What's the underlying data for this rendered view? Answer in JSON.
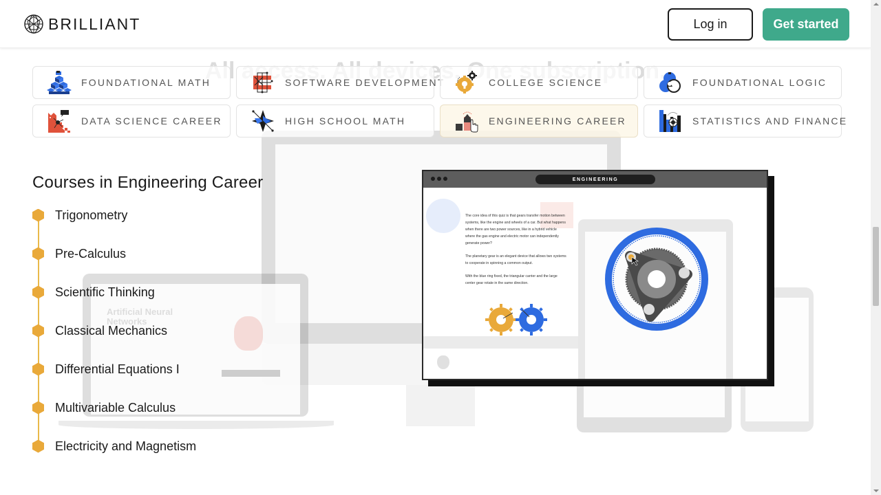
{
  "header": {
    "logo_text": "BRILLIANT",
    "login_label": "Log in",
    "get_started_label": "Get started",
    "accent_color": "#3fa98b"
  },
  "background": {
    "tagline": "All access. All devices. One subscription.",
    "laptop_caption": "Artificial Neural Networks"
  },
  "categories": [
    {
      "label": "Foundational Math",
      "icon": "foundational-math-icon",
      "active": false
    },
    {
      "label": "Software Development",
      "icon": "software-development-icon",
      "active": false
    },
    {
      "label": "College Science",
      "icon": "college-science-icon",
      "active": false
    },
    {
      "label": "Foundational Logic",
      "icon": "foundational-logic-icon",
      "active": false
    },
    {
      "label": "Data Science Career",
      "icon": "data-science-career-icon",
      "active": false
    },
    {
      "label": "High School Math",
      "icon": "high-school-math-icon",
      "active": false
    },
    {
      "label": "Engineering Career",
      "icon": "engineering-career-icon",
      "active": true
    },
    {
      "label": "Statistics and Finance",
      "icon": "statistics-finance-icon",
      "active": false
    }
  ],
  "courses": {
    "title": "Courses in Engineering Career",
    "items": [
      "Trigonometry",
      "Pre-Calculus",
      "Scientific Thinking",
      "Classical Mechanics",
      "Differential Equations I",
      "Multivariable Calculus",
      "Electricity and Magnetism"
    ],
    "bullet_color": "#e9a93a"
  },
  "preview": {
    "window_title": "ENGINEERING",
    "paragraphs": [
      "The core idea of this quiz is that gears transfer motion between systems, like the engine and wheels of a car. But what happens when there are two power sources, like in a hybrid vehicle where the gas engine and electric motor can independently generate power?",
      "The planetary gear is an elegant device that allows two systems to cooperate in spinning a common output.",
      "With the blue ring fixed, the triangular carrier and the large center gear rotate in the same direction."
    ],
    "gear_colors": {
      "orange": "#e9a93a",
      "blue": "#2e6be0",
      "carrier": "#4a4a4a"
    }
  }
}
